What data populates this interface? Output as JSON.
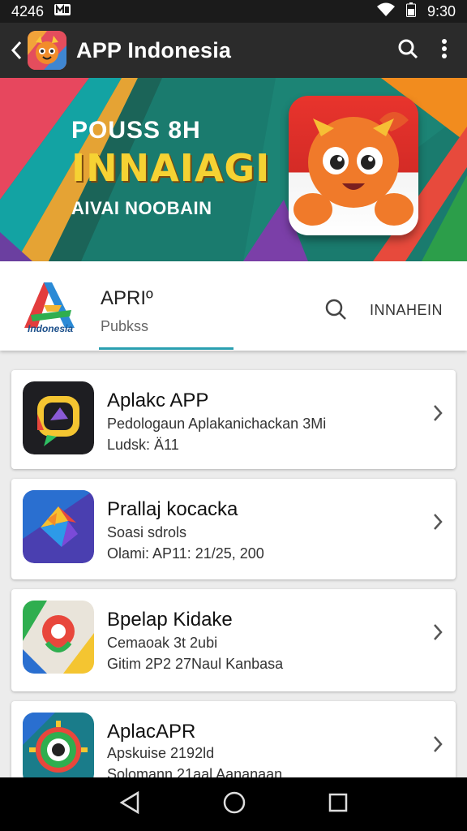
{
  "status_bar": {
    "left_text": "4246",
    "time": "9:30"
  },
  "app_bar": {
    "title": "APP Indonesia"
  },
  "banner": {
    "line1": "POUSS 8H",
    "line2": "INNAIAGI",
    "line3": "AIVAI NOOBAIN"
  },
  "developer": {
    "logo_text": "Indonesia",
    "name": "APRIº",
    "subtitle": "Pubkss",
    "action_label": "INNAHEIN"
  },
  "apps": [
    {
      "title": "Aplakc APP",
      "line1": "Pedologaun Aplakanichackan 3Mi",
      "line2": "Ludsk: Ä11",
      "icon": "chat-app-icon"
    },
    {
      "title": "Prallaj kocacka",
      "line1": "Soasi sdrols",
      "line2": "Olami: AP11: 21/25, 200",
      "icon": "shapes-app-icon"
    },
    {
      "title": "Bpelap Kidake",
      "line1": "Cemaoak 3t 2ubi",
      "line2": "Gitim 2P2 27Naul Kanbasa",
      "icon": "map-pin-app-icon"
    },
    {
      "title": "AplacAPR",
      "line1": "Apskuise 2192ld",
      "line2": "Solomann 21aal Aananaan",
      "icon": "gear-eye-app-icon"
    }
  ],
  "colors": {
    "status_bar": "#1b1b1b",
    "app_bar": "#2b2b2b",
    "banner_teal": "#1c7f72",
    "accent_underline": "#2a9fb0",
    "banner_yellow_text": "#f6d233",
    "nav_bar": "#000000"
  }
}
